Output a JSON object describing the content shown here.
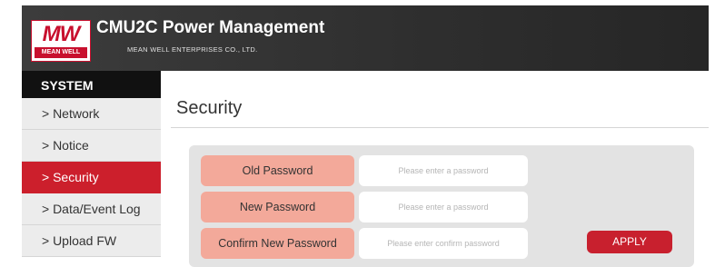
{
  "header": {
    "logo": {
      "mark": "MW",
      "text": "MEAN WELL"
    },
    "title": "CMU2C Power Management",
    "subtitle": "MEAN WELL ENTERPRISES CO., LTD."
  },
  "sidebar": {
    "heading": "SYSTEM",
    "items": [
      {
        "label": "> Network",
        "active": false
      },
      {
        "label": "> Notice",
        "active": false
      },
      {
        "label": "> Security",
        "active": true
      },
      {
        "label": "> Data/Event Log",
        "active": false
      },
      {
        "label": "> Upload FW",
        "active": false
      }
    ]
  },
  "main": {
    "title": "Security",
    "form": {
      "old_password": {
        "label": "Old Password",
        "value": "",
        "placeholder": "Please enter a password"
      },
      "new_password": {
        "label": "New Password",
        "value": "",
        "placeholder": "Please enter a password"
      },
      "confirm_password": {
        "label": "Confirm New Password",
        "value": "",
        "placeholder": "Please enter confirm password"
      },
      "apply_label": "APPLY"
    }
  },
  "colors": {
    "brand_red": "#c8202e",
    "label_salmon": "#f3a99a",
    "header_dark": "#2e2e2e",
    "sidebar_header": "#111111",
    "panel_gray": "#e3e3e3"
  }
}
